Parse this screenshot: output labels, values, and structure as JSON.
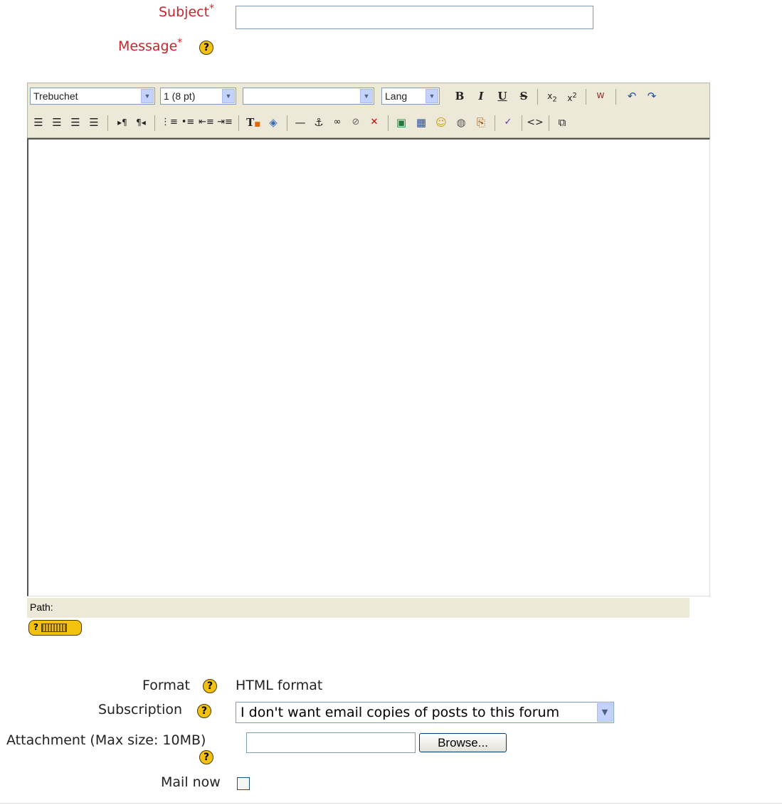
{
  "subject": {
    "label": "Subject",
    "required_mark": "*",
    "value": ""
  },
  "message": {
    "label": "Message",
    "required_mark": "*",
    "help": "?"
  },
  "editor": {
    "font_family": "Trebuchet",
    "font_size": "1 (8 pt)",
    "paragraph": "",
    "lang": "Lang",
    "toolbar_row1_icons": [
      "bold-icon",
      "italic-icon",
      "underline-icon",
      "strikethrough-icon",
      "subscript-icon",
      "superscript-icon",
      "clean-word-icon",
      "undo-icon",
      "redo-icon"
    ],
    "toolbar_row2_icons": [
      "align-left-icon",
      "align-center-icon",
      "align-right-icon",
      "justify-icon",
      "ltr-icon",
      "rtl-icon",
      "ordered-list-icon",
      "unordered-list-icon",
      "outdent-icon",
      "indent-icon",
      "text-color-icon",
      "background-color-icon",
      "horizontal-rule-icon",
      "anchor-icon",
      "link-icon",
      "unlink-icon",
      "nolink-icon",
      "image-icon",
      "table-icon",
      "smiley-icon",
      "special-char-icon",
      "search-replace-icon",
      "spellcheck-icon",
      "html-source-icon",
      "fullscreen-icon"
    ],
    "path_label": "Path:",
    "keyboard_help": "?"
  },
  "format": {
    "label": "Format",
    "value": "HTML format",
    "help": "?"
  },
  "subscription": {
    "label": "Subscription",
    "selected": "I don't want email copies of posts to this forum",
    "help": "?"
  },
  "attachment": {
    "label": "Attachment (Max size: 10MB)",
    "value": "",
    "browse_label": "Browse...",
    "help": "?"
  },
  "mailnow": {
    "label": "Mail now",
    "checked": false
  },
  "colors": {
    "required_label": "#c4262b",
    "required_star": "#e01c1c",
    "help_icon": "#f2c20f",
    "toolbar_bg": "#ece9d8"
  }
}
